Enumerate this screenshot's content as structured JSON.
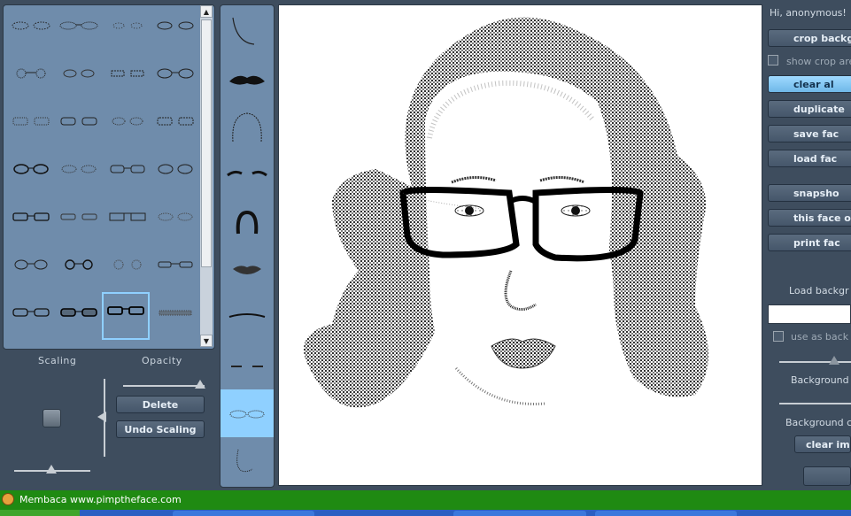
{
  "labels": {
    "scaling": "Scaling",
    "opacity": "Opacity"
  },
  "buttons": {
    "delete": "Delete",
    "undo_scaling": "Undo Scaling"
  },
  "right_panel": {
    "greeting": "Hi, anonymous!",
    "crop_background": "crop backgr",
    "show_crop_area": "show crop are",
    "clear_all": "clear al",
    "duplicate": "duplicate",
    "save_face": "save fac",
    "load_face": "load fac",
    "snapshot": "snapsho",
    "this_face_on": "this face on",
    "print_face": "print fac",
    "load_background": "Load backgr",
    "use_as_background": "use as back",
    "background_label": "Background",
    "background_c_label": "Background c",
    "clear_image": "clear ima"
  },
  "taskbar": {
    "title": "Membaca www.pimptheface.com"
  },
  "colors": {
    "panel": "#6f8cab",
    "selected": "#8fd0ff",
    "background": "#3e4d5e",
    "taskbar": "#1f8a12"
  }
}
